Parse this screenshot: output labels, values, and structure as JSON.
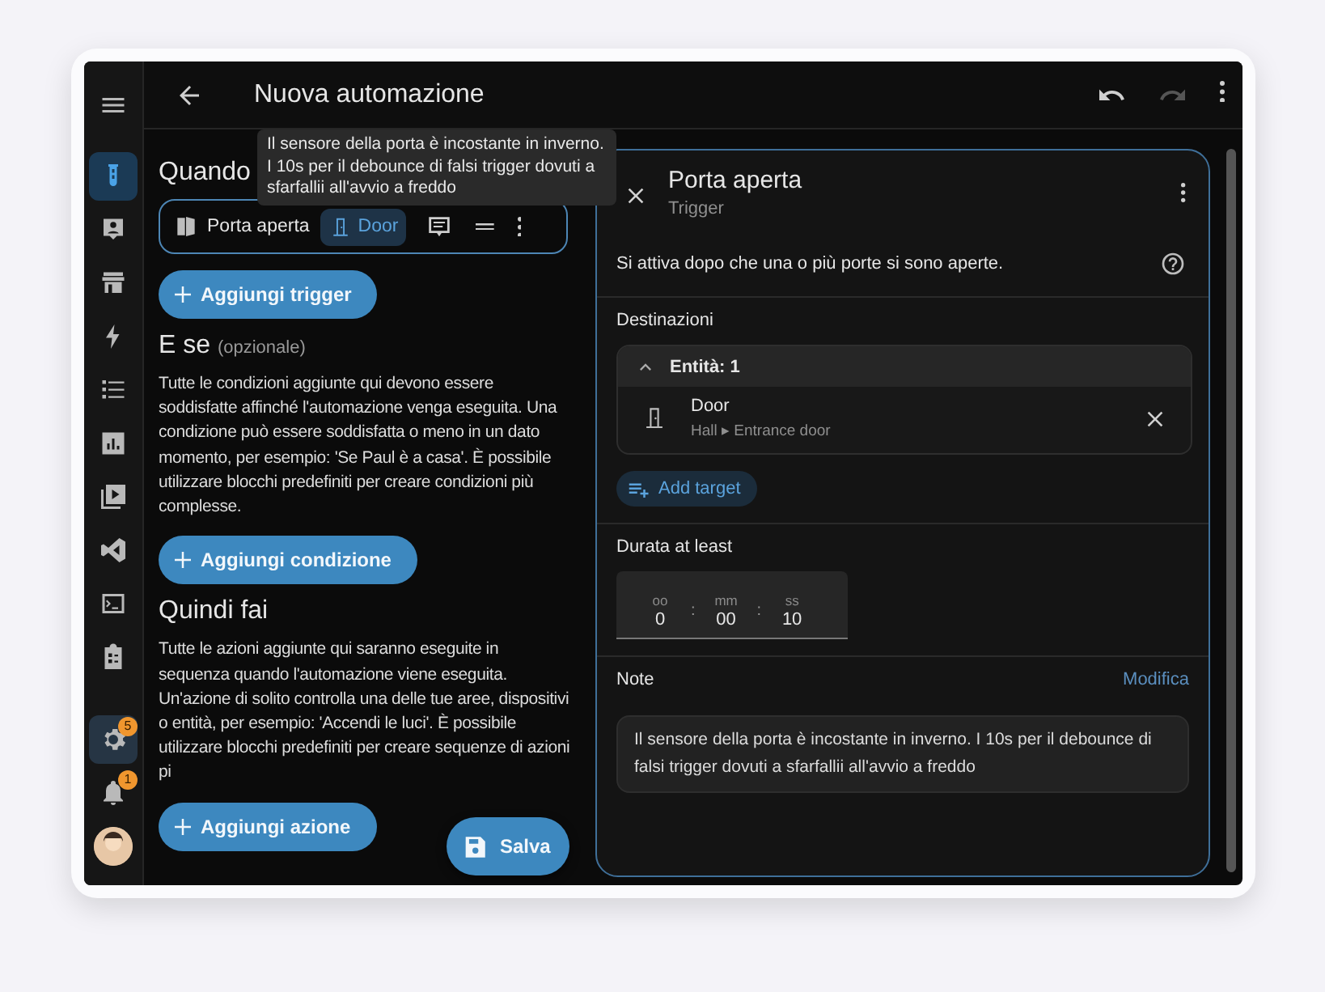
{
  "sidebar": {
    "items": [
      {
        "kind": "menu",
        "selected": false
      },
      {
        "kind": "automation",
        "selected": true
      },
      {
        "kind": "person",
        "selected": false
      },
      {
        "kind": "store",
        "selected": false
      },
      {
        "kind": "bolt",
        "selected": false
      },
      {
        "kind": "list",
        "selected": false
      },
      {
        "kind": "chart",
        "selected": false
      },
      {
        "kind": "media",
        "selected": false
      },
      {
        "kind": "code",
        "selected": false
      },
      {
        "kind": "terminal",
        "selected": false
      },
      {
        "kind": "clipboard",
        "selected": false
      }
    ],
    "bottom_items": [
      {
        "kind": "settings",
        "selected": true,
        "badge": "5"
      },
      {
        "kind": "bell",
        "selected": false,
        "badge": "1"
      },
      {
        "kind": "avatar",
        "selected": false
      }
    ]
  },
  "toolbar": {
    "title": "Nuova automazione",
    "actions": [
      {
        "kind": "undo",
        "disabled": false
      },
      {
        "kind": "redo",
        "disabled": true
      },
      {
        "kind": "more",
        "disabled": false
      }
    ]
  },
  "editor": {
    "sections": [
      {
        "kind": "triggers",
        "title": "Quando",
        "triggers": [
          {
            "label": "Porta aperta",
            "target": "Door"
          }
        ],
        "button": "Aggiungi trigger"
      },
      {
        "kind": "conditions",
        "title": "E se",
        "optional": "(opzionale)",
        "description": "Tutte le condizioni aggiunte qui devono essere soddisfatte affinché l'automazione venga eseguita. Una condizione può essere soddisfatta o meno in un dato momento, per esempio: 'Se Paul è a casa'. È possibile utilizzare blocchi predefiniti per creare condizioni più complesse.",
        "button": "Aggiungi condizione"
      },
      {
        "kind": "actions",
        "title": "Quindi fai",
        "description": "Tutte le azioni aggiunte qui saranno eseguite in sequenza quando l'automazione viene eseguita. Un'azione di solito controlla una delle tue aree, dispositivi o entità, per esempio: 'Accendi le luci'. È possibile utilizzare blocchi predefiniti per creare sequenze di azioni pi",
        "button": "Aggiungi azione"
      }
    ],
    "tooltip": "Il sensore della porta è incostante in inverno. I 10s per il debounce di falsi trigger dovuti a sfarfallii all'avvio a freddo",
    "save_button": "Salva"
  },
  "panel": {
    "title": "Porta aperta",
    "subtitle": "Trigger",
    "description": "Si attiva dopo che una o più porte si sono aperte.",
    "targets": {
      "label": "Destinazioni",
      "group": {
        "label": "Entità: 1",
        "expanded": true,
        "entities": [
          {
            "name": "Door",
            "area": "Hall",
            "separator": "▸",
            "device": "Entrance door"
          }
        ]
      },
      "add_button": "Add target"
    },
    "duration": {
      "label": "Durata at least",
      "separator": ":",
      "fields": [
        {
          "label": "oo",
          "value": "0"
        },
        {
          "label": "mm",
          "value": "00"
        },
        {
          "label": "ss",
          "value": "10"
        }
      ]
    },
    "notes": {
      "label": "Note",
      "edit_link": "Modifica",
      "text": "Il sensore della porta è incostante in inverno. I 10s per il debounce di falsi trigger dovuti a sfarfallii all'avvio a freddo"
    }
  }
}
